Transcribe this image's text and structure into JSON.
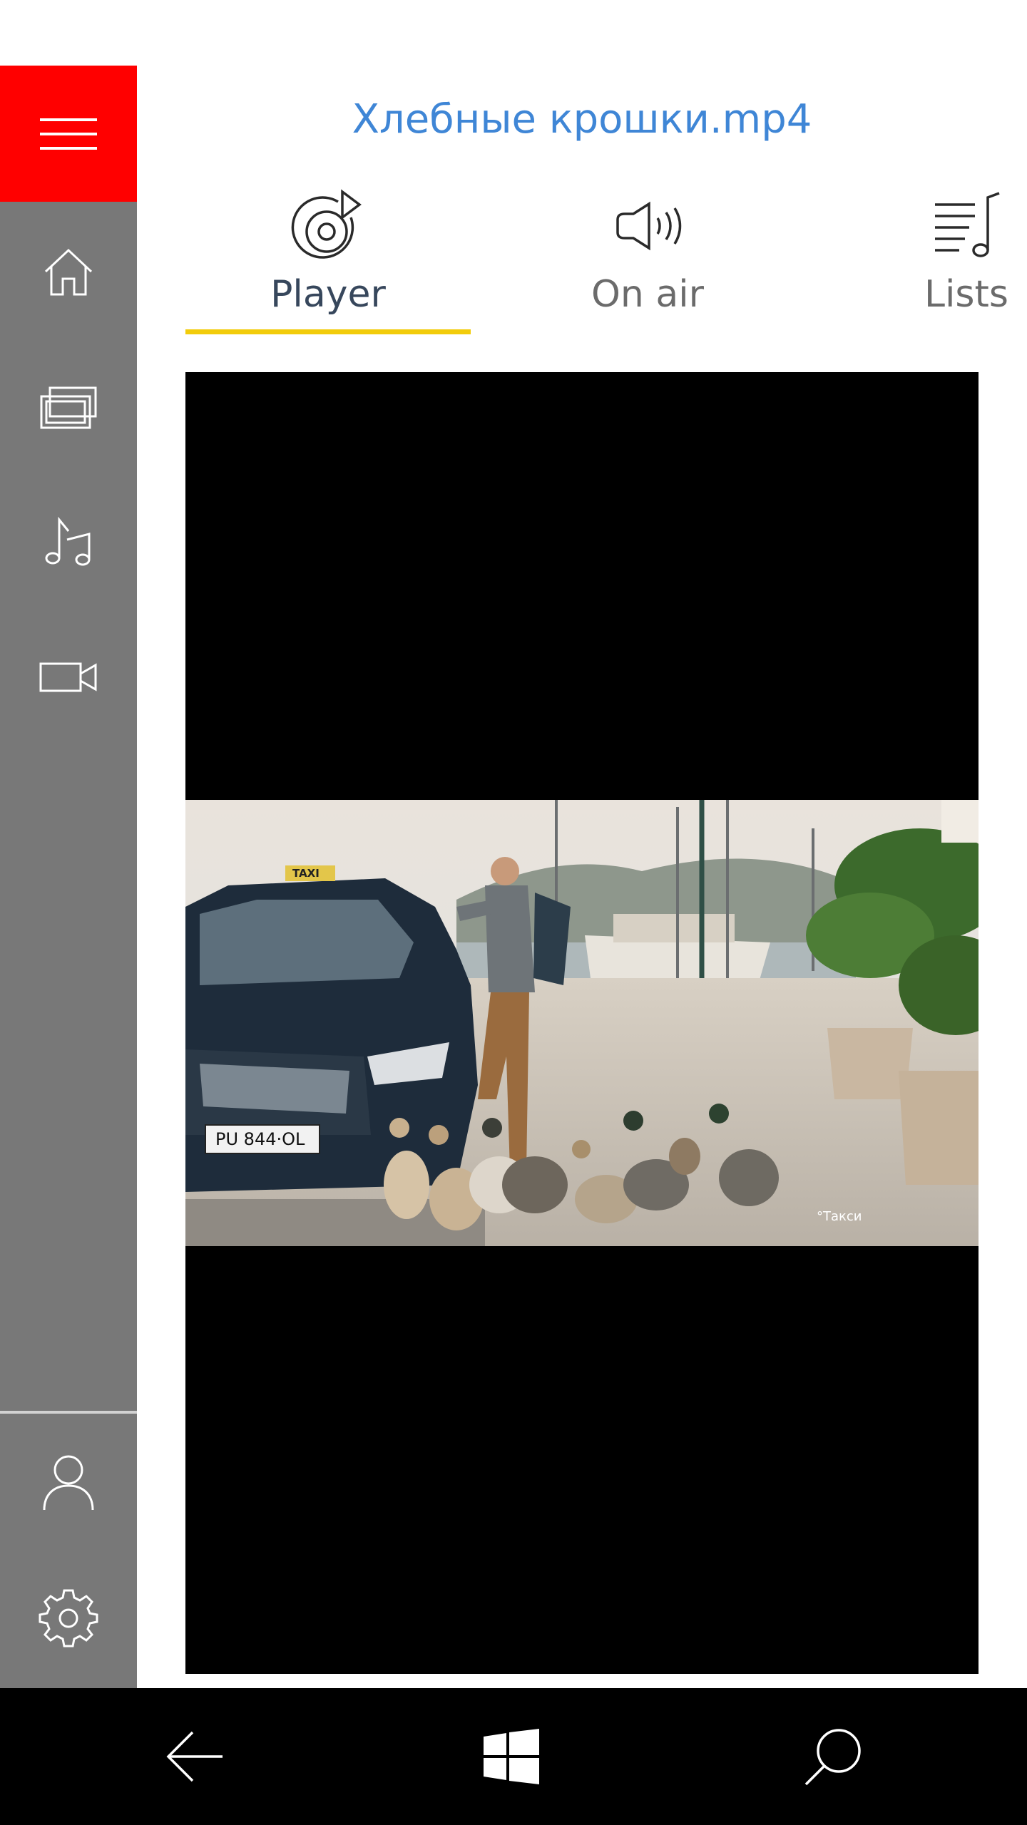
{
  "header": {
    "title": "Хлебные крошки.mp4"
  },
  "sidebar": {
    "menu_icon": "hamburger-icon",
    "items": [
      {
        "id": "home",
        "icon": "home-icon"
      },
      {
        "id": "gallery",
        "icon": "photos-icon"
      },
      {
        "id": "music",
        "icon": "music-note-icon"
      },
      {
        "id": "video",
        "icon": "video-camera-icon"
      }
    ],
    "bottom_items": [
      {
        "id": "account",
        "icon": "person-icon"
      },
      {
        "id": "settings",
        "icon": "gear-icon"
      }
    ]
  },
  "tabs": [
    {
      "label": "Player",
      "icon": "disc-play-icon",
      "active": true
    },
    {
      "label": "On air",
      "icon": "speaker-icon",
      "active": false
    },
    {
      "label": "Lists",
      "icon": "playlist-icon",
      "active": false
    }
  ],
  "player": {
    "subtitle": "°Такси",
    "plate": "PU 844·OL",
    "taxi_sign": "TAXI"
  },
  "system_bar": {
    "back_icon": "back-arrow-icon",
    "start_icon": "windows-logo-icon",
    "search_icon": "search-icon"
  },
  "colors": {
    "accent_red": "#ff0000",
    "title_blue": "#3f86d6",
    "tab_underline": "#f2cc0b",
    "rail_gray": "#787878"
  }
}
